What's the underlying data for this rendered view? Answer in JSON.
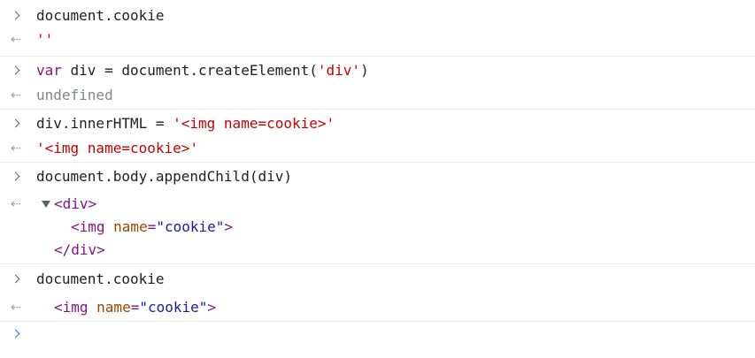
{
  "entries": [
    {
      "input": {
        "plain": "document.cookie"
      },
      "output": {
        "string": "''"
      }
    },
    {
      "input": {
        "keyword": "var",
        "middle": " div = document.createElement(",
        "string": "'div'",
        "end": ")"
      },
      "output": {
        "grey": "undefined"
      }
    },
    {
      "input": {
        "start": "div.innerHTML = ",
        "string": "'<img name=cookie>'"
      },
      "output": {
        "string": "'<img name=cookie>'"
      }
    },
    {
      "input": {
        "plain": "document.body.appendChild(div)"
      },
      "output": {
        "open_tag": "<div>",
        "child": {
          "open": "<img",
          "attr_name": " name",
          "eq": "=",
          "attr_value": "\"cookie\"",
          "close": ">"
        },
        "close_tag": "</div>"
      }
    },
    {
      "input": {
        "plain": "document.cookie"
      },
      "output": {
        "element": {
          "open": "<img",
          "attr_name": " name",
          "eq": "=",
          "attr_value": "\"cookie\"",
          "close": ">"
        }
      }
    }
  ],
  "icons": {
    "input_prompt": "chevron-right-icon",
    "output_return": "return-arrow-icon",
    "expand": "triangle-down-icon"
  },
  "colors": {
    "keyword": "#881280",
    "string": "#c80000",
    "undefined": "#80868b",
    "attribute_name": "#994500",
    "attribute_value": "#1a1aa6",
    "prompt": "#1a73e8",
    "separator": "#e8eaed"
  }
}
